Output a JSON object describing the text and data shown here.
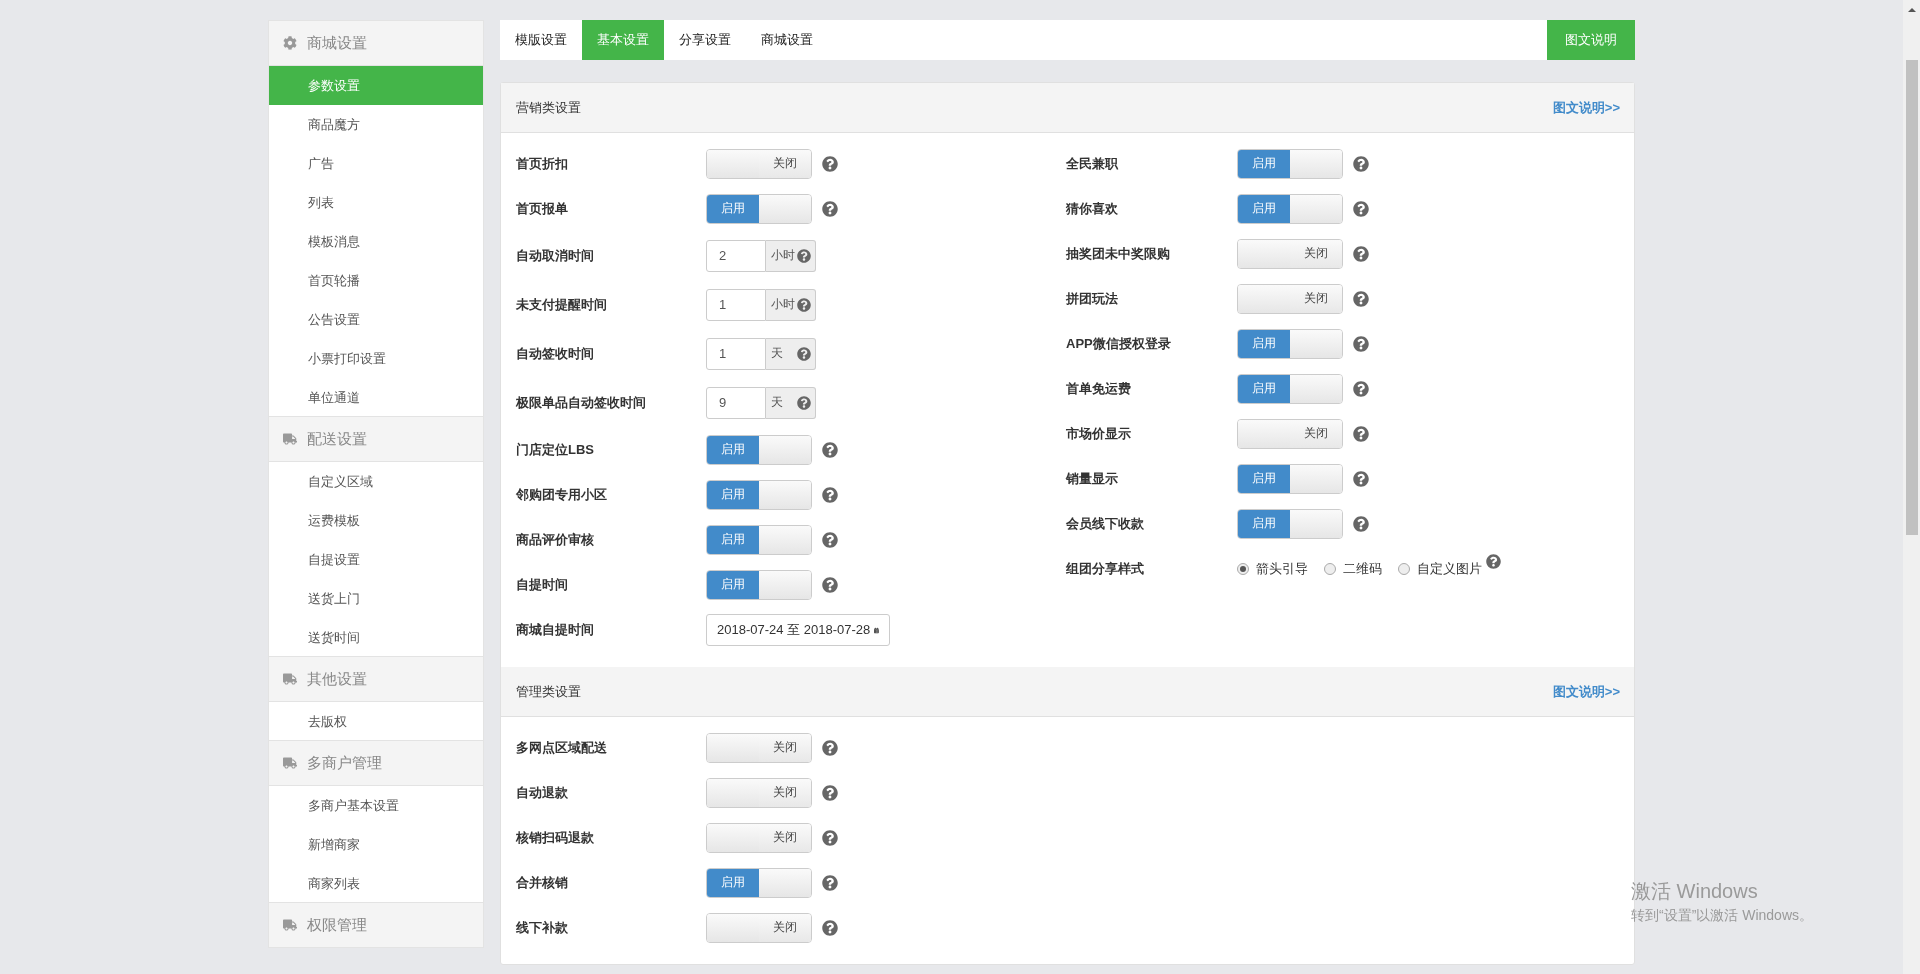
{
  "sidebar": {
    "groups": [
      {
        "title": "商城设置",
        "items": [
          {
            "label": "参数设置",
            "selected": true
          },
          {
            "label": "商品魔方",
            "selected": false
          },
          {
            "label": "广告",
            "selected": false
          },
          {
            "label": "列表",
            "selected": false
          },
          {
            "label": "模板消息",
            "selected": false
          },
          {
            "label": "首页轮播",
            "selected": false
          },
          {
            "label": "公告设置",
            "selected": false
          },
          {
            "label": "小票打印设置",
            "selected": false
          },
          {
            "label": "单位通道",
            "selected": false
          }
        ]
      },
      {
        "title": "配送设置",
        "items": [
          {
            "label": "自定义区域",
            "selected": false
          },
          {
            "label": "运费模板",
            "selected": false
          },
          {
            "label": "自提设置",
            "selected": false
          },
          {
            "label": "送货上门",
            "selected": false
          },
          {
            "label": "送货时间",
            "selected": false
          }
        ]
      },
      {
        "title": "其他设置",
        "items": [
          {
            "label": "去版权",
            "selected": false
          }
        ]
      },
      {
        "title": "多商户管理",
        "items": [
          {
            "label": "多商户基本设置",
            "selected": false
          },
          {
            "label": "新增商家",
            "selected": false
          },
          {
            "label": "商家列表",
            "selected": false
          }
        ]
      },
      {
        "title": "权限管理"
      }
    ]
  },
  "tabs": [
    {
      "label": "模版设置",
      "selected": false
    },
    {
      "label": "基本设置",
      "selected": true
    },
    {
      "label": "分享设置",
      "selected": false
    },
    {
      "label": "商城设置",
      "selected": false
    }
  ],
  "help_button": "图文说明",
  "sections": [
    {
      "title": "营销类设置",
      "link": "图文说明>>",
      "columns": [
        [
          {
            "kind": "toggle",
            "label": "首页折扣",
            "on": false,
            "text": "关闭"
          },
          {
            "kind": "toggle",
            "label": "首页报单",
            "on": true,
            "text": "启用"
          },
          {
            "kind": "number",
            "label": "自动取消时间",
            "value": "2",
            "unit": "小时"
          },
          {
            "kind": "number",
            "label": "未支付提醒时间",
            "value": "1",
            "unit": "小时"
          },
          {
            "kind": "number",
            "label": "自动签收时间",
            "value": "1",
            "unit": "天"
          },
          {
            "kind": "number",
            "label": "极限单品自动签收时间",
            "value": "9",
            "unit": "天"
          },
          {
            "kind": "toggle",
            "label": "门店定位LBS",
            "on": true,
            "text": "启用"
          },
          {
            "kind": "toggle",
            "label": "邻购团专用小区",
            "on": true,
            "text": "启用"
          },
          {
            "kind": "toggle",
            "label": "商品评价审核",
            "on": true,
            "text": "启用"
          },
          {
            "kind": "toggle",
            "label": "自提时间",
            "on": true,
            "text": "启用"
          },
          {
            "kind": "date",
            "label": "商城自提时间",
            "value": "2018-07-24 至 2018-07-28"
          }
        ],
        [
          {
            "kind": "toggle",
            "label": "全民兼职",
            "on": true,
            "text": "启用"
          },
          {
            "kind": "toggle",
            "label": "猜你喜欢",
            "on": true,
            "text": "启用"
          },
          {
            "kind": "toggle",
            "label": "抽奖团未中奖限购",
            "on": false,
            "text": "关闭"
          },
          {
            "kind": "toggle",
            "label": "拼团玩法",
            "on": false,
            "text": "关闭"
          },
          {
            "kind": "toggle",
            "label": "APP微信授权登录",
            "on": true,
            "text": "启用"
          },
          {
            "kind": "toggle",
            "label": "首单免运费",
            "on": true,
            "text": "启用"
          },
          {
            "kind": "toggle",
            "label": "市场价显示",
            "on": false,
            "text": "关闭"
          },
          {
            "kind": "toggle",
            "label": "销量显示",
            "on": true,
            "text": "启用"
          },
          {
            "kind": "toggle",
            "label": "会员线下收款",
            "on": true,
            "text": "启用"
          },
          {
            "kind": "radio",
            "label": "组团分享样式",
            "options": [
              {
                "label": "箭头引导",
                "selected": true
              },
              {
                "label": "二维码",
                "selected": false
              },
              {
                "label": "自定义图片",
                "selected": false
              }
            ]
          }
        ]
      ]
    },
    {
      "title": "管理类设置",
      "link": "图文说明>>",
      "columns": [
        [
          {
            "kind": "toggle",
            "label": "多网点区域配送",
            "on": false,
            "text": "关闭"
          },
          {
            "kind": "toggle",
            "label": "自动退款",
            "on": false,
            "text": "关闭"
          },
          {
            "kind": "toggle",
            "label": "核销扫码退款",
            "on": false,
            "text": "关闭"
          },
          {
            "kind": "toggle",
            "label": "合并核销",
            "on": true,
            "text": "启用"
          },
          {
            "kind": "toggle",
            "label": "线下补款",
            "on": false,
            "text": "关闭"
          }
        ]
      ]
    }
  ],
  "watermark": {
    "title": "激活 Windows",
    "subtitle": "转到“设置”以激活 Windows。"
  }
}
